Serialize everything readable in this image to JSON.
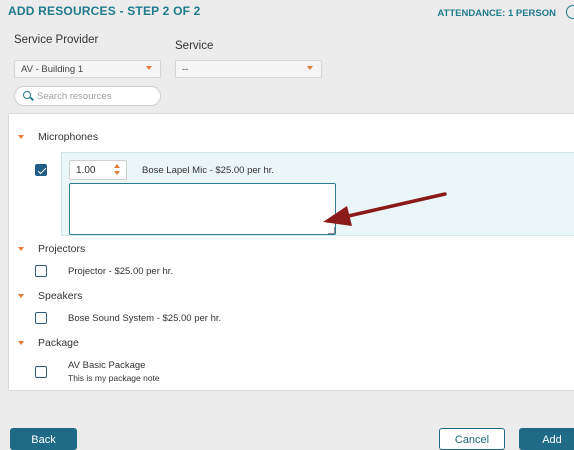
{
  "header": {
    "title": "ADD RESOURCES - STEP 2 OF 2",
    "attendance": "ATTENDANCE: 1 PERSON"
  },
  "filters": {
    "service_provider_label": "Service Provider",
    "service_provider_value": "AV - Building 1",
    "service_label": "Service",
    "service_value": "--",
    "search_placeholder": "Search resources"
  },
  "categories": [
    {
      "name": "Microphones",
      "items": [
        {
          "label": "Bose Lapel Mic  - $25.00  per hr.",
          "checked": true,
          "quantity": "1.00",
          "note": ""
        }
      ]
    },
    {
      "name": "Projectors",
      "items": [
        {
          "label": "Projector  - $25.00  per hr.",
          "checked": false
        }
      ]
    },
    {
      "name": "Speakers",
      "items": [
        {
          "label": "Bose Sound System  - $25.00  per hr.",
          "checked": false
        }
      ]
    },
    {
      "name": "Package",
      "items": [
        {
          "label": "AV Basic Package",
          "sublabel": "This is my package note",
          "checked": false
        }
      ]
    }
  ],
  "footer": {
    "back_label": "Back",
    "cancel_label": "Cancel",
    "add_label": "Add"
  },
  "colors": {
    "accent": "#1f7a8c",
    "primary_button": "#1f6a86",
    "caret": "#e07b3a",
    "annotation_arrow": "#8b1a1a"
  },
  "icons": [
    "search-icon",
    "help-icon",
    "chevron-down-icon",
    "checkbox-icon",
    "spinner-up-icon",
    "spinner-down-icon",
    "resize-grip-icon"
  ]
}
